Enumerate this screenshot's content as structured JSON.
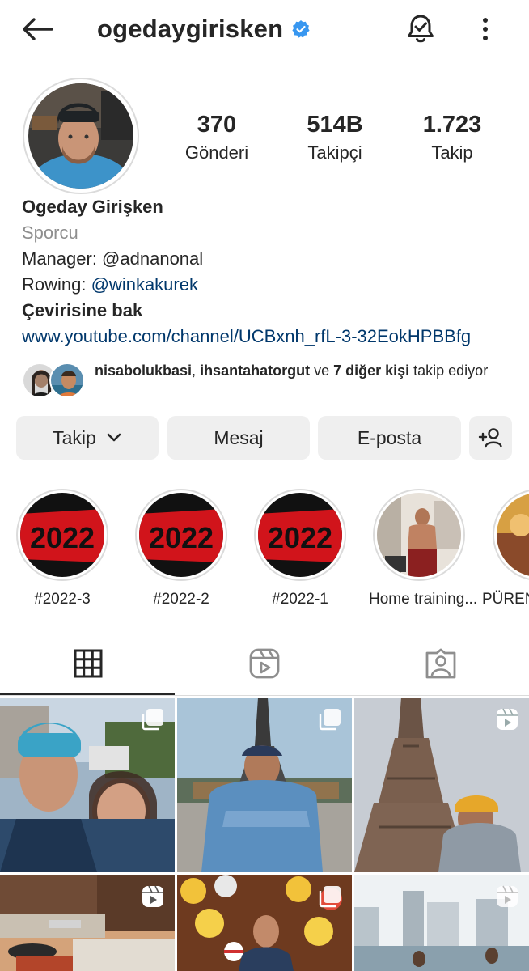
{
  "header": {
    "username": "ogedaygirisken",
    "verified_icon": "verified-badge-icon",
    "back_icon": "arrow-left-icon",
    "bell_icon": "bell-check-icon",
    "more_icon": "more-vertical-icon"
  },
  "stats": [
    {
      "value": "370",
      "label": "Gönderi"
    },
    {
      "value": "514B",
      "label": "Takipçi"
    },
    {
      "value": "1.723",
      "label": "Takip"
    }
  ],
  "bio": {
    "name": "Ogeday Girişken",
    "category": "Sporcu",
    "manager_line": "Manager: @adnanonal",
    "rowing_prefix": "Rowing: ",
    "rowing_mention": "@winkakurek",
    "translate": "Çevirisine bak",
    "link": "www.youtube.com/channel/UCBxnh_rfL-3-32EokHPBBfg"
  },
  "followed_by": {
    "user1": "nisabolukbasi",
    "sep": ", ",
    "user2": "ihsantahatorgut",
    "and": " ve ",
    "others": "7 diğer kişi",
    "suffix": " takip ediyor"
  },
  "actions": {
    "follow_label": "Takip",
    "message_label": "Mesaj",
    "email_label": "E-posta",
    "add_person_icon": "add-person-icon"
  },
  "highlights": [
    {
      "label": "#2022-3"
    },
    {
      "label": "#2022-2"
    },
    {
      "label": "#2022-1"
    },
    {
      "label": "Home training..."
    },
    {
      "label": "PÜREN"
    }
  ],
  "highlight_cover_text": "2022",
  "tabs": [
    {
      "name": "grid",
      "icon": "grid-icon",
      "active": true
    },
    {
      "name": "reels",
      "icon": "reels-icon",
      "active": false
    },
    {
      "name": "tagged",
      "icon": "tagged-person-icon",
      "active": false
    }
  ],
  "posts": [
    {
      "badge": "multi-photo-icon"
    },
    {
      "badge": "multi-photo-icon"
    },
    {
      "badge": "reels-icon"
    },
    {
      "badge": "reels-icon"
    },
    {
      "badge": "multi-photo-icon"
    },
    {
      "badge": "reels-icon"
    }
  ],
  "colors": {
    "text": "#262626",
    "link": "#00376b",
    "secondary": "#8e8e8e",
    "verified_blue": "#3897f0",
    "button_bg": "#efefef"
  }
}
